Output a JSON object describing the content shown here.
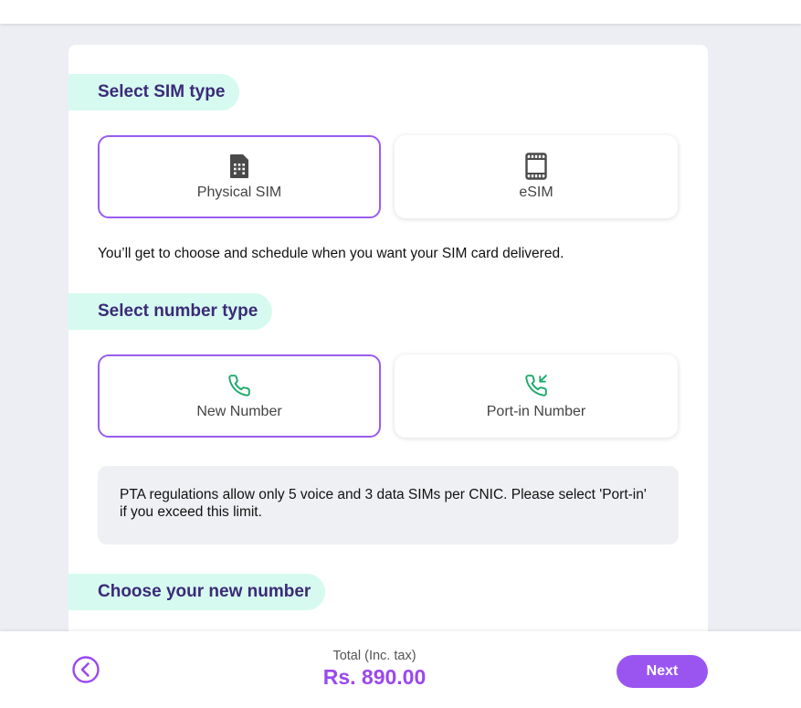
{
  "sim_section": {
    "title": "Select SIM type",
    "options": [
      {
        "label": "Physical SIM",
        "icon": "sim-card-icon",
        "selected": true
      },
      {
        "label": "eSIM",
        "icon": "esim-icon",
        "selected": false
      }
    ],
    "helper": "You’ll get to choose and schedule when you want your SIM card delivered."
  },
  "number_section": {
    "title": "Select number type",
    "options": [
      {
        "label": "New Number",
        "icon": "phone-icon",
        "selected": true
      },
      {
        "label": "Port-in Number",
        "icon": "phone-incoming-icon",
        "selected": false
      }
    ],
    "notice": "PTA regulations allow only 5 voice and 3 data SIMs per CNIC. Please select 'Port-in' if you exceed this limit."
  },
  "choose_section": {
    "title": "Choose your new number"
  },
  "footer": {
    "total_label": "Total (Inc. tax)",
    "total_value": "Rs. 890.00",
    "next_label": "Next",
    "back_icon": "chevron-left-circle-icon"
  },
  "colors": {
    "accent": "#9a55f0",
    "pill_bg": "#d6faf0",
    "heading": "#3b2a78",
    "icon_green": "#1faa6b"
  }
}
